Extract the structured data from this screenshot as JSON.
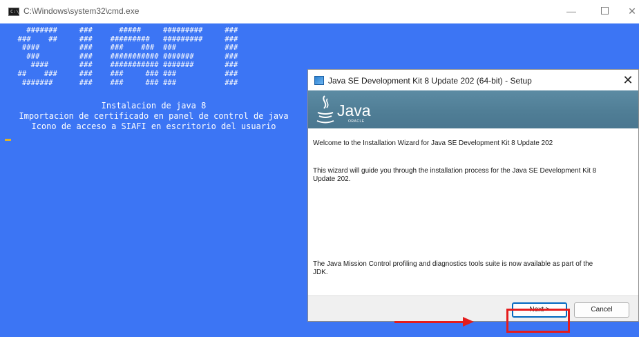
{
  "cmd": {
    "title": "C:\\Windows\\system32\\cmd.exe",
    "icon_text": "C:\\",
    "ascii_art": "      #######     ###      #####     #########     ###\n    ###    ##     ###    #########   #########     ###\n     ####         ###    ###    ###  ###           ###\n      ###         ###    ########### #######       ###\n       ####       ###    ########### #######       ###\n    ##    ###     ###    ###     ### ###           ###\n     #######      ###    ###     ### ###           ###",
    "lines": [
      "Instalacion de java 8",
      "Importacion de certificado en panel de control de java",
      "Icono de acceso a SIAFI en escritorio del usuario"
    ],
    "window_controls": {
      "minimize": "—",
      "close": "✕"
    }
  },
  "dialog": {
    "title": "Java SE Development Kit 8 Update 202 (64-bit) - Setup",
    "close": "✕",
    "logo_text": "Java",
    "logo_subtext": "ORACLE",
    "welcome": "Welcome to the Installation Wizard for Java SE Development Kit 8 Update 202",
    "guide": "This wizard will guide you through the installation process for the Java SE Development Kit 8 Update 202.",
    "note": "The Java Mission Control profiling and diagnostics tools suite is now available as part of the JDK.",
    "next_label": "Next >",
    "cancel_label": "Cancel"
  },
  "colors": {
    "console_bg": "#3c75f4",
    "annotation": "#e51c1c",
    "banner": "#5c8ba3"
  }
}
